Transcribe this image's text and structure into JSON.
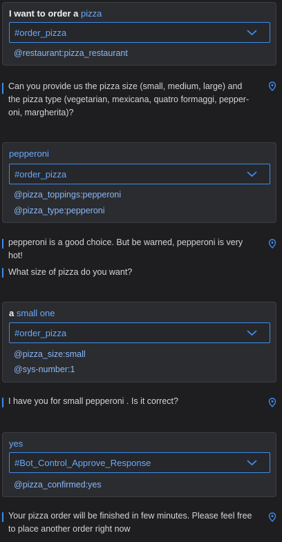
{
  "conversation": {
    "turns": [
      {
        "utterance_prefix": "I want to order a",
        "utterance_value": "pizza",
        "intent": "#order_pizza",
        "entities": [
          "@restaurant:pizza_restaurant"
        ]
      },
      {
        "utterance_prefix": "",
        "utterance_value": "pepperoni",
        "intent": "#order_pizza",
        "entities": [
          "@pizza_toppings:pepperoni",
          "@pizza_type:pepperoni"
        ]
      },
      {
        "utterance_prefix": "a",
        "utterance_value": "small one",
        "intent": "#order_pizza",
        "entities": [
          "@pizza_size:small",
          "@sys-number:1"
        ]
      },
      {
        "utterance_prefix": "",
        "utterance_value": "yes",
        "intent": "#Bot_Control_Approve_Response",
        "entities": [
          "@pizza_confirmed:yes"
        ]
      }
    ],
    "bot_responses": [
      "Can you provide us the pizza size (small, medium, large) and the pizza type (vegetarian, mexicana, quatro formaggi, pepper-oni, margherita)?",
      "pepperoni is a good choice. But be warned, pepperoni is very hot!",
      "What size of pizza do you want?",
      "I have you for small pepperoni . Is it correct?",
      "Your pizza order will be finished in few minutes. Please feel free to place another order right now"
    ]
  },
  "icons": {
    "dropdown": "chevron-down-icon",
    "location": "location-pin-icon"
  },
  "colors": {
    "background": "#1e1e20",
    "card": "#2b2c2f",
    "accent": "#3f8cf0",
    "entity_text": "#8ab8f8"
  }
}
